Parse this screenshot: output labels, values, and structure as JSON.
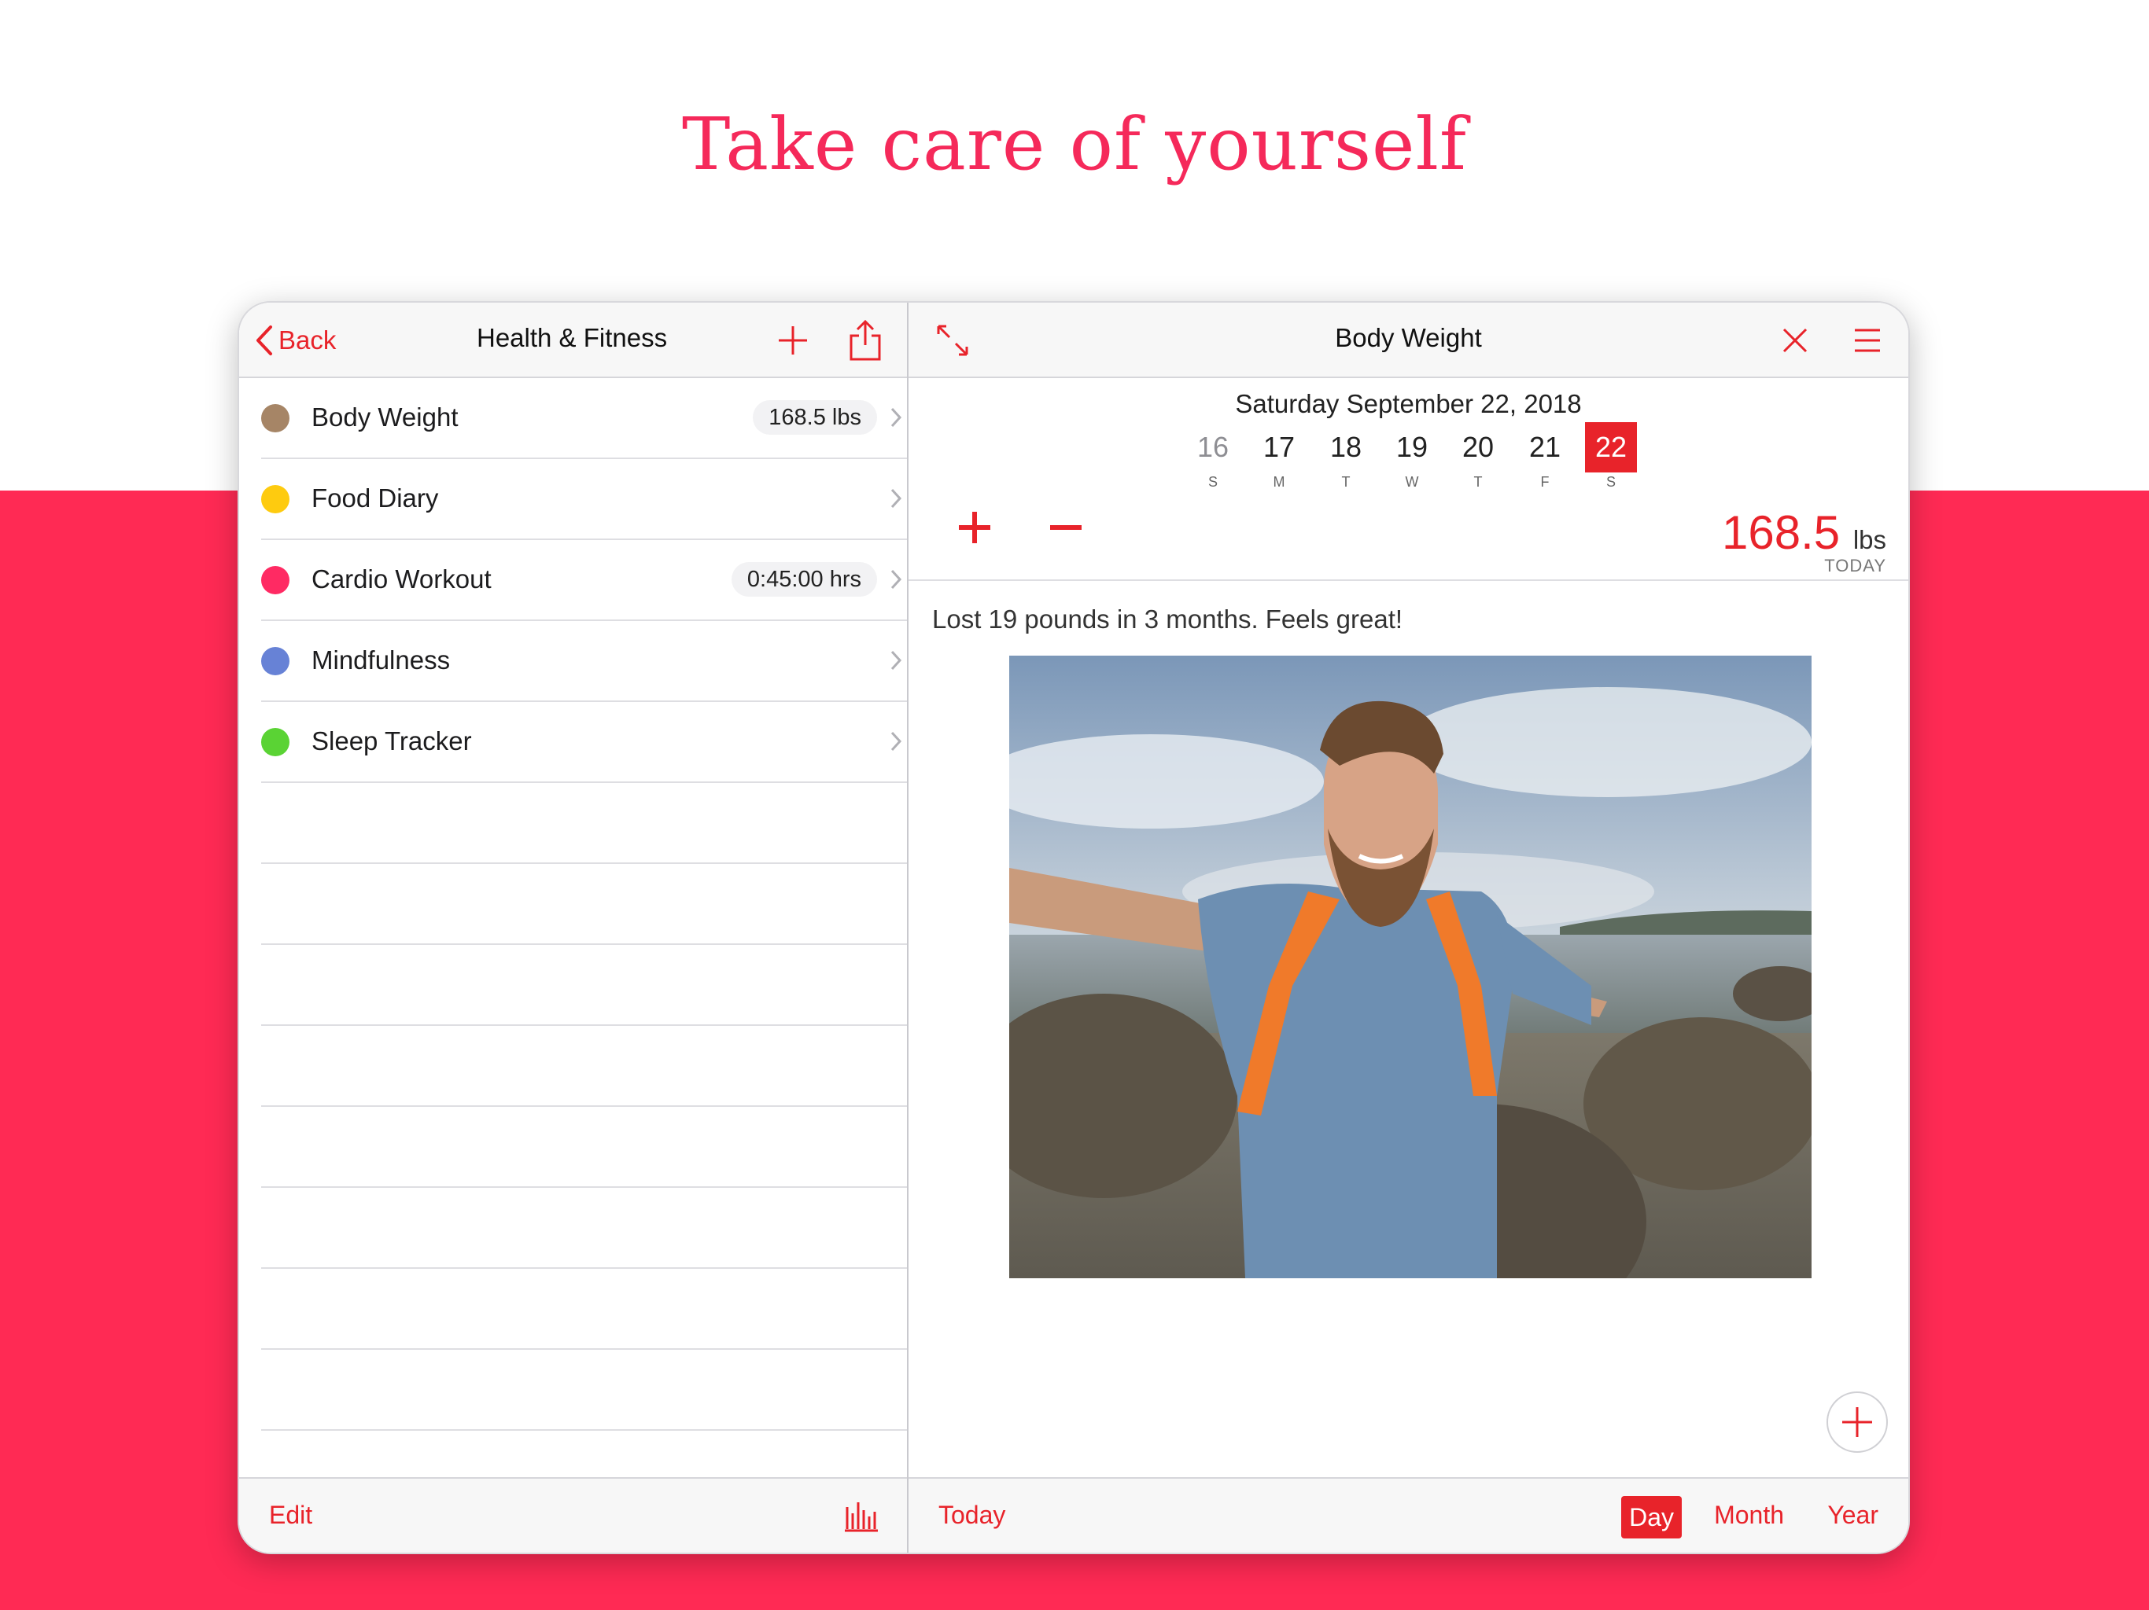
{
  "headline": "Take care of yourself",
  "colors": {
    "accent": "#e8232a",
    "band": "#ff2a54",
    "headline": "#f5295a"
  },
  "master": {
    "back_label": "Back",
    "title": "Health & Fitness",
    "items": [
      {
        "label": "Body Weight",
        "value": "168.5 lbs",
        "color": "#a68566"
      },
      {
        "label": "Food Diary",
        "value": "",
        "color": "#fecb0f"
      },
      {
        "label": "Cardio Workout",
        "value": "0:45:00 hrs",
        "color": "#ff2a63"
      },
      {
        "label": "Mindfulness",
        "value": "",
        "color": "#6782d6"
      },
      {
        "label": "Sleep Tracker",
        "value": "",
        "color": "#5ad334"
      }
    ],
    "toolbar": {
      "edit_label": "Edit"
    }
  },
  "detail": {
    "title": "Body Weight",
    "date_heading": "Saturday  September 22, 2018",
    "days": [
      {
        "num": "16",
        "letter": "S"
      },
      {
        "num": "17",
        "letter": "M"
      },
      {
        "num": "18",
        "letter": "T"
      },
      {
        "num": "19",
        "letter": "W"
      },
      {
        "num": "20",
        "letter": "T"
      },
      {
        "num": "21",
        "letter": "F"
      },
      {
        "num": "22",
        "letter": "S"
      }
    ],
    "weight_value": "168.5",
    "weight_unit": "lbs",
    "weight_caption": "TODAY",
    "note": "Lost 19 pounds in 3 months. Feels great!",
    "toolbar": {
      "today_label": "Today",
      "day_label": "Day",
      "month_label": "Month",
      "year_label": "Year"
    }
  }
}
